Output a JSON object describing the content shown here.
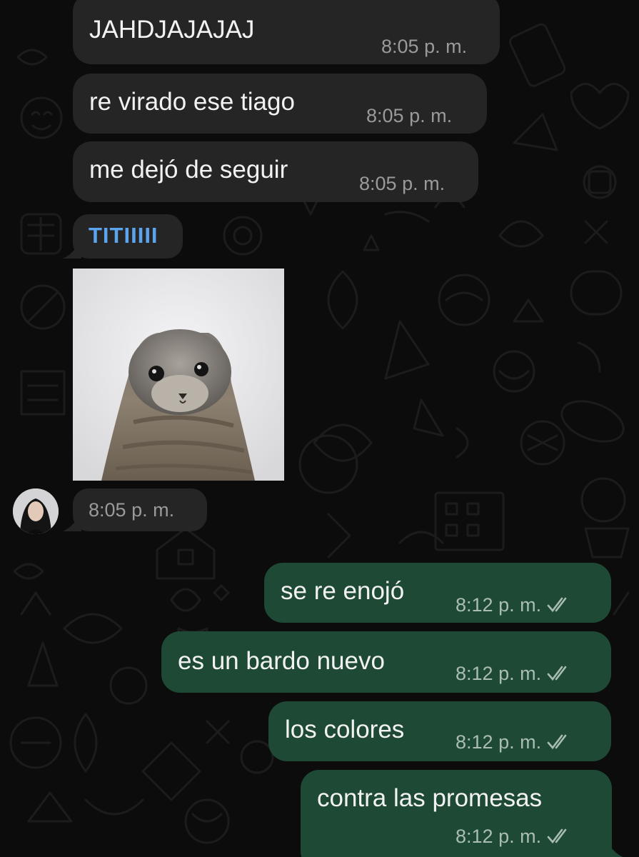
{
  "conversation": {
    "incoming": [
      {
        "text": "JAHDJAJAJAJ",
        "time": "8:05",
        "ampm": "p. m."
      },
      {
        "text": "re virado ese tiago",
        "time": "8:05",
        "ampm": "p. m."
      },
      {
        "text": "me dejó de seguir",
        "time": "8:05",
        "ampm": "p. m."
      }
    ],
    "reply_sender": "TITIIIII",
    "image_message": {
      "image_icon": "seal-photo",
      "time": "8:05",
      "ampm": "p. m."
    },
    "outgoing": [
      {
        "text": "se re enojó",
        "time": "8:12",
        "ampm": "p. m.",
        "status_icon": "double-check-read"
      },
      {
        "text": "es un bardo nuevo",
        "time": "8:12",
        "ampm": "p. m.",
        "status_icon": "double-check-read"
      },
      {
        "text": "los colores",
        "time": "8:12",
        "ampm": "p. m.",
        "status_icon": "double-check-read"
      },
      {
        "text": "contra las promesas",
        "time": "8:12",
        "ampm": "p. m.",
        "status_icon": "double-check-read"
      }
    ]
  },
  "colors": {
    "background": "#0c0c0c",
    "incoming_bubble": "#252525",
    "outgoing_bubble": "#1e4a35",
    "sender_name": "#5ba4ee",
    "timestamp": "#9a9a9a"
  }
}
